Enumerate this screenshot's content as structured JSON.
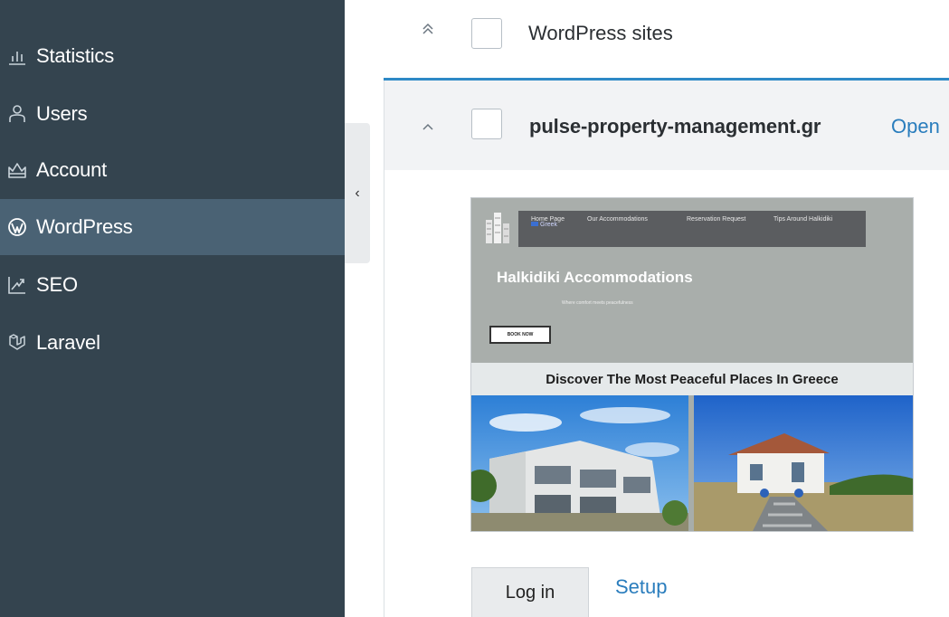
{
  "sidebar": {
    "items": [
      {
        "label": "Statistics",
        "icon": "bar-chart-icon"
      },
      {
        "label": "Users",
        "icon": "user-icon"
      },
      {
        "label": "Account",
        "icon": "crown-icon"
      },
      {
        "label": "WordPress",
        "icon": "wordpress-icon",
        "active": true
      },
      {
        "label": "SEO",
        "icon": "trend-icon"
      },
      {
        "label": "Laravel",
        "icon": "laravel-icon"
      }
    ],
    "collapse_glyph": "‹"
  },
  "main": {
    "section": {
      "title": "WordPress sites",
      "chevron": "⌃⌃"
    },
    "site": {
      "name": "pulse-property-management.gr",
      "open_label": "Open",
      "chevron": "⌃",
      "preview": {
        "nav": [
          "Home Page",
          "Our Accommodations",
          "Reservation Request",
          "Tips Around Halkidiki"
        ],
        "lang": "Greek",
        "hero_title": "Halkidiki Accommodations",
        "hero_sub": "Where comfort meets peacefulness",
        "book_label": "BOOK NOW",
        "discover": "Discover The Most Peaceful Places In Greece"
      },
      "login_label": "Log in",
      "setup_label": "Setup"
    }
  },
  "colors": {
    "sidebar_bg": "#34444f",
    "sidebar_active": "#4a6274",
    "link": "#2a7dbd",
    "card_accent": "#2e89c6"
  }
}
